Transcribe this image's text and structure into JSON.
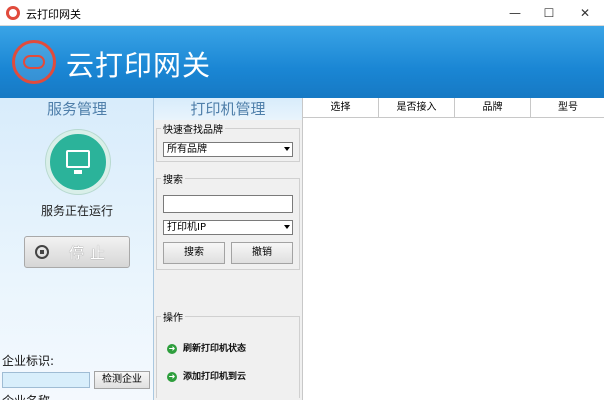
{
  "window": {
    "title": "云打印网关",
    "min_glyph": "—",
    "max_glyph": "☐",
    "close_glyph": "✕"
  },
  "header": {
    "app_title": "云打印网关"
  },
  "nav": {
    "service_tab": "服务管理",
    "printer_tab": "打印机管理"
  },
  "service": {
    "status_text": "服务正在运行",
    "stop_label": "停止"
  },
  "company": {
    "id_label": "企业标识:",
    "detect_button": "检测企业",
    "name_label": "企业名称"
  },
  "brand_group": {
    "title": "快速查找品牌",
    "selected": "所有品牌"
  },
  "search_group": {
    "title": "搜索",
    "input_value": "",
    "field_selected": "打印机IP",
    "search_button": "搜索",
    "cancel_button": "撤销"
  },
  "operations": {
    "title": "操作",
    "items": [
      {
        "label": "刷新打印机状态"
      },
      {
        "label": "添加打印机到云"
      }
    ]
  },
  "table": {
    "columns": [
      "选择",
      "是否接入",
      "品牌",
      "型号"
    ]
  },
  "colors": {
    "banner": "#1a86d4",
    "status_green": "#2bb39a",
    "logo_red": "#e14b3c"
  }
}
